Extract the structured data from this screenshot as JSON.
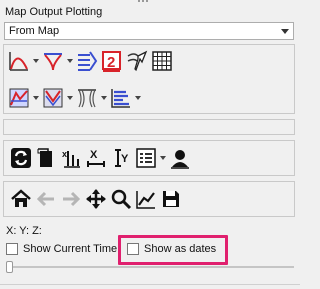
{
  "panel": {
    "title": "Map Output Plotting",
    "source_select": {
      "value": "From Map"
    }
  },
  "toolbar1": {
    "icons": [
      "line-plot-icon",
      "funnel-plot-icon",
      "series-align-icon",
      "number-two-icon",
      "cursor-select-icon",
      "grid-table-icon"
    ]
  },
  "toolbar2": {
    "icons": [
      "area-chart-icon",
      "multi-funnel-icon",
      "curtain-icon",
      "stacked-bars-icon"
    ]
  },
  "toolbar3": {
    "icons": [
      "refresh-icon",
      "document-icon",
      "x-axis-plot-icon",
      "x-error-icon",
      "y-error-icon",
      "options-list-icon",
      "person-icon"
    ]
  },
  "toolbar4": {
    "icons": [
      "home-icon",
      "back-arrow-icon",
      "forward-arrow-icon",
      "pan-move-icon",
      "zoom-magnifier-icon",
      "trend-chart-icon",
      "save-disk-icon"
    ]
  },
  "coords_label": "X: Y: Z:",
  "options": {
    "show_current_time": {
      "label": "Show Current Time",
      "checked": false
    },
    "show_as_dates": {
      "label": "Show as dates",
      "checked": false
    }
  },
  "slider": {
    "value": 0
  },
  "colors": {
    "accent_red": "#d8232a",
    "accent_blue": "#3a4fd0",
    "highlight": "#e0206e"
  }
}
